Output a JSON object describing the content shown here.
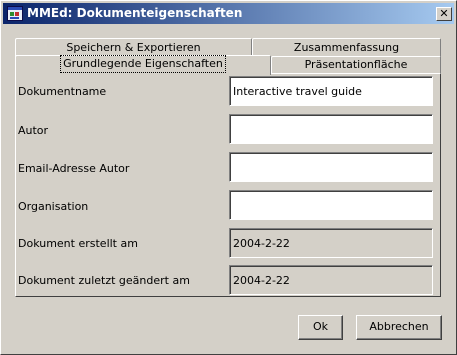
{
  "window": {
    "title": "MMEd: Dokumenteigenschaften",
    "close_glyph": "✕"
  },
  "tabs": {
    "row_back": [
      {
        "label": "Speichern & Exportieren"
      },
      {
        "label": "Zusammenfassung"
      }
    ],
    "row_front": [
      {
        "label": "Grundlegende Eigenschaften",
        "selected": true
      },
      {
        "label": "Präsentationfläche",
        "selected": false
      }
    ]
  },
  "form": {
    "fields": [
      {
        "label": "Dokumentname",
        "value": "Interactive travel guide",
        "editable": true
      },
      {
        "label": "Autor",
        "value": "",
        "editable": true
      },
      {
        "label": "Email-Adresse Autor",
        "value": "",
        "editable": true
      },
      {
        "label": "Organisation",
        "value": "",
        "editable": true
      },
      {
        "label": "Dokument erstellt am",
        "value": "2004-2-22",
        "editable": false
      },
      {
        "label": "Dokument zuletzt geändert am",
        "value": "2004-2-22",
        "editable": false
      }
    ]
  },
  "buttons": {
    "ok_label": "Ok",
    "cancel_label": "Abbrechen"
  },
  "icons": {
    "app": "app-document-icon",
    "close": "close-icon"
  },
  "colors": {
    "titlebar_start": "#0a246a",
    "titlebar_end": "#a6caf0",
    "face": "#d4d0c8"
  }
}
